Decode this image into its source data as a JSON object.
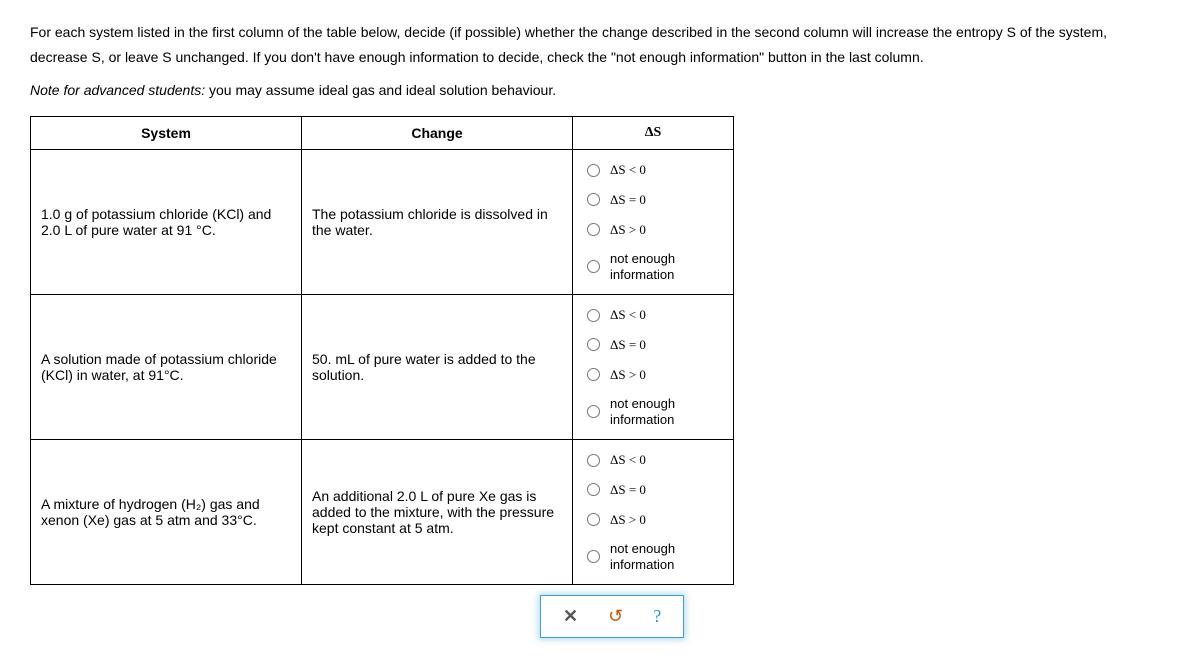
{
  "instructions": "For each system listed in the first column of the table below, decide (if possible) whether the change described in the second column will increase the entropy S of the system, decrease S, or leave S unchanged. If you don't have enough information to decide, check the \"not enough information\" button in the last column.",
  "note_prefix": "Note for advanced students:",
  "note_text": " you may assume ideal gas and ideal solution behaviour.",
  "headers": {
    "system": "System",
    "change": "Change",
    "ds": "ΔS"
  },
  "options": {
    "lt": "ΔS < 0",
    "eq": "ΔS = 0",
    "gt": "ΔS > 0",
    "nei_line1": "not enough",
    "nei_line2": "information"
  },
  "rows": [
    {
      "system": "1.0 g of potassium chloride (KCl) and 2.0 L of pure water at 91 °C.",
      "change": "The potassium chloride is dissolved in the water."
    },
    {
      "system": "A solution made of potassium chloride (KCl) in water, at 91°C.",
      "change": "50. mL of pure water is added to the solution."
    },
    {
      "system": "A mixture of hydrogen (H₂) gas and xenon (Xe) gas at 5 atm and 33°C.",
      "change": "An additional 2.0 L of pure Xe gas is added to the mixture, with the pressure kept constant at 5 atm."
    }
  ],
  "actions": {
    "clear": "✕",
    "reset": "↺",
    "help": "?"
  }
}
